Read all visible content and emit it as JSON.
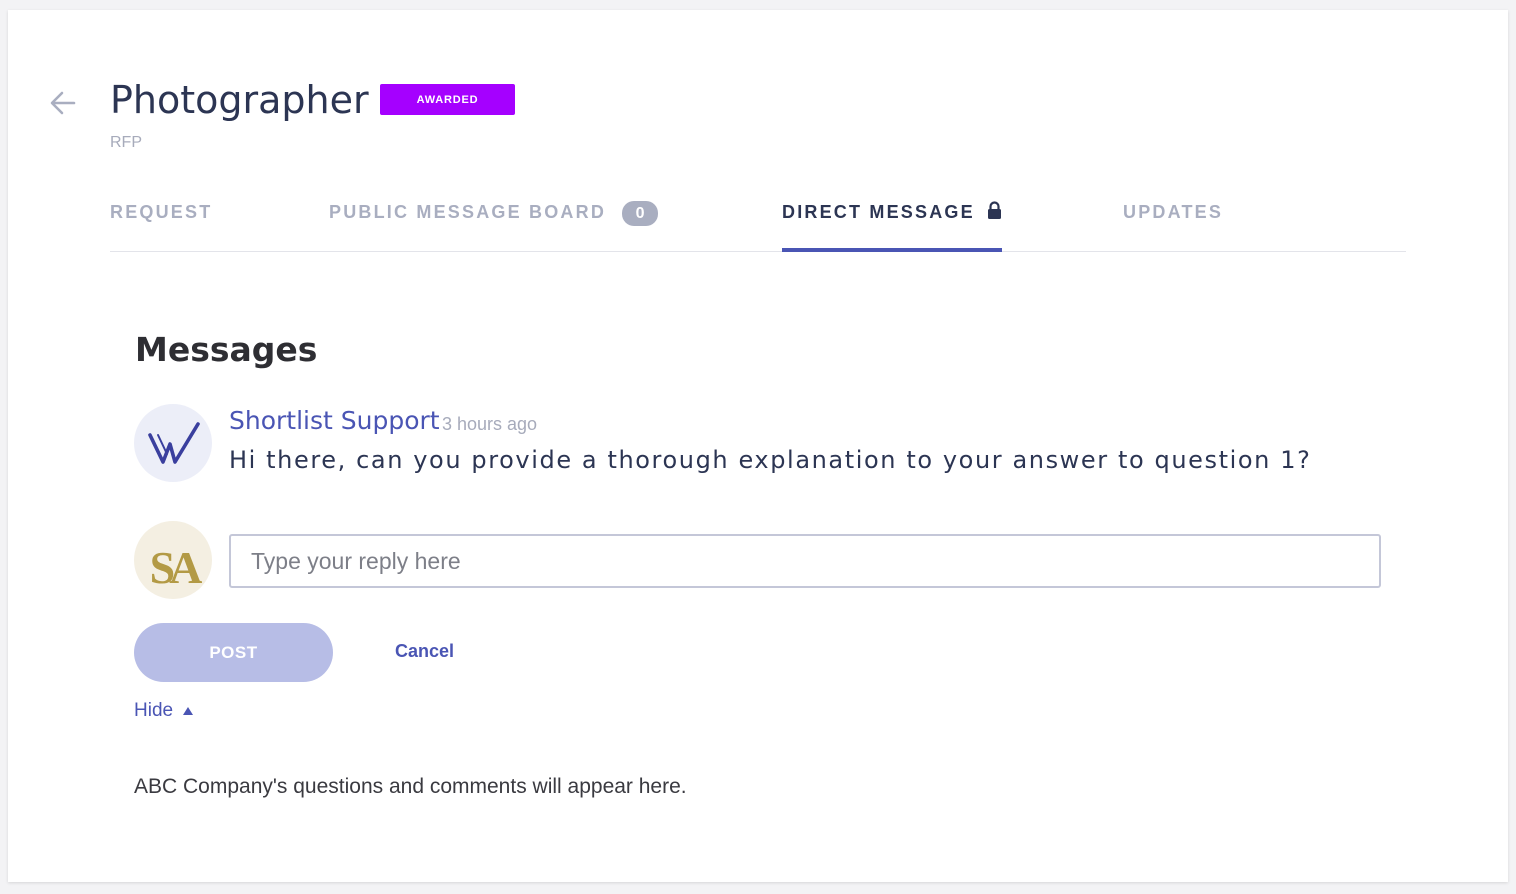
{
  "header": {
    "title": "Photographer",
    "badge": "AWARDED",
    "subtitle": "RFP",
    "badge_color": "#a500ff"
  },
  "tabs": [
    {
      "label": "REQUEST",
      "active": false
    },
    {
      "label": "PUBLIC MESSAGE BOARD",
      "count": "0",
      "active": false
    },
    {
      "label": "DIRECT MESSAGE",
      "icon": "lock-icon",
      "active": true
    },
    {
      "label": "UPDATES",
      "active": false
    }
  ],
  "messages_section": {
    "title": "Messages",
    "messages": [
      {
        "author": "Shortlist Support",
        "time": "3 hours ago",
        "body": "Hi there, can you provide a thorough explanation to your answer to question 1?",
        "avatar_icon": "shortlist-logo-icon"
      }
    ],
    "reply": {
      "placeholder": "Type your reply here",
      "value": "",
      "avatar_icon": "sa-logo-icon"
    },
    "post_label": "POST",
    "cancel_label": "Cancel",
    "hide_label": "Hide",
    "info": "ABC Company's questions and comments will appear here."
  },
  "colors": {
    "accent": "#4a55b4",
    "title": "#2c3553",
    "muted": "#a9aec0",
    "post_button": "#b7bde6"
  }
}
